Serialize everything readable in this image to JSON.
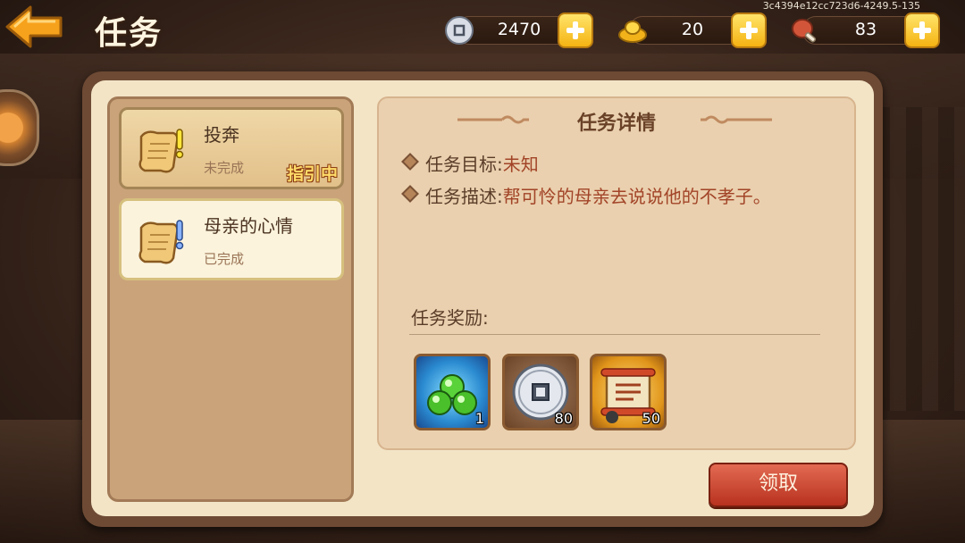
{
  "header": {
    "title": "任务",
    "uid": "3c4394e12cc723d6-4249.5-135"
  },
  "resources": [
    {
      "icon": "silver-coin-icon",
      "value": "2470"
    },
    {
      "icon": "gold-ingot-icon",
      "value": "20"
    },
    {
      "icon": "meat-icon",
      "value": "83"
    }
  ],
  "tasks": [
    {
      "name": "投奔",
      "status": "未完成",
      "badge": "指引中"
    },
    {
      "name": "母亲的心情",
      "status": "已完成"
    }
  ],
  "detail": {
    "title": "任务详情",
    "goal_label": "任务目标:",
    "goal_value": "未知",
    "desc_label": "任务描述:",
    "desc_value": "帮可怜的母亲去说说他的不孝子。",
    "reward_label": "任务奖励:",
    "rewards": [
      {
        "icon": "green-orbs-icon",
        "count": "1"
      },
      {
        "icon": "silver-coin-icon",
        "count": "80"
      },
      {
        "icon": "scroll-item-icon",
        "count": "50"
      }
    ]
  },
  "claim_label": "领取",
  "colors": {
    "accent": "#f5b312",
    "button": "#c84530",
    "panel": "#f3e4c6"
  }
}
